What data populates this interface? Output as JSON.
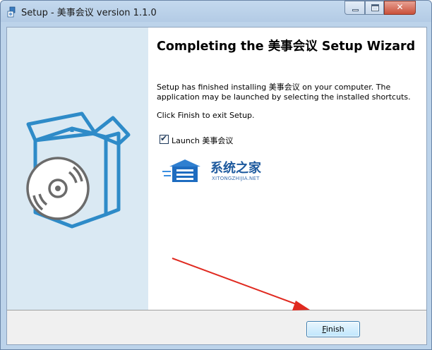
{
  "window": {
    "title": "Setup - 美事会议 version 1.1.0",
    "buttons": {
      "minimize": "minimize",
      "maximize": "maximize",
      "close": "✕"
    }
  },
  "wizard": {
    "heading": "Completing the 美事会议 Setup Wizard",
    "finished_text": "Setup has finished installing 美事会议 on your computer. The application may be launched by selecting the installed shortcuts.",
    "exit_text": "Click Finish to exit Setup.",
    "launch_checkbox": {
      "label": "Launch 美事会议",
      "checked": true
    }
  },
  "watermark": {
    "title": "系统之家",
    "subtitle": "XITONGZHIJIA.NET"
  },
  "footer": {
    "finish_mnemonic": "F",
    "finish_rest": "inish"
  },
  "colors": {
    "side_panel": "#dae9f3",
    "box_blue": "#2e8bc8",
    "arrow_red": "#e02a20",
    "watermark_blue": "#1e5a9e"
  }
}
